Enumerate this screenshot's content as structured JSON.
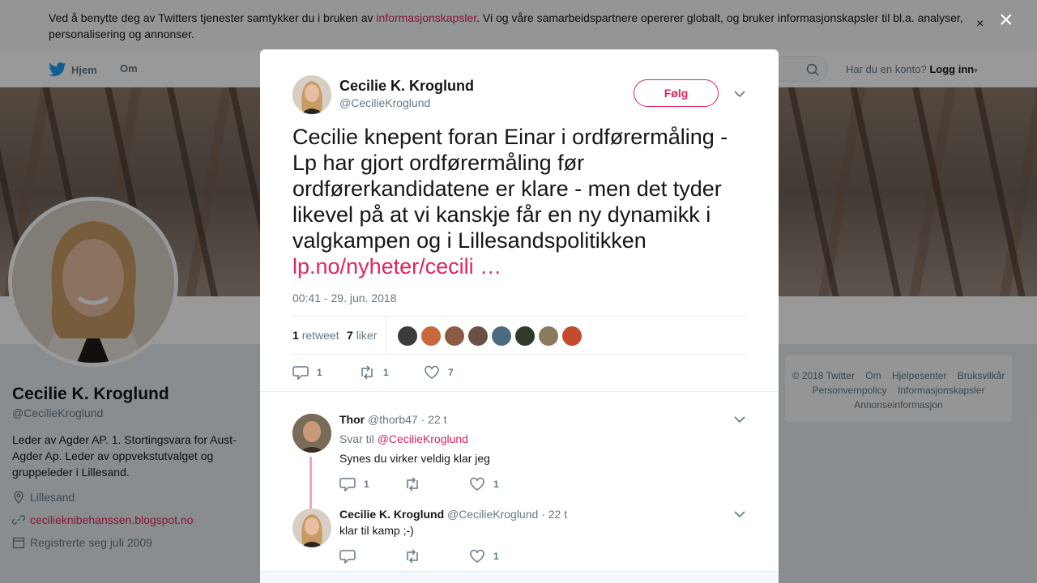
{
  "cookie": {
    "text_before": "Ved å benytte deg av Twitters tjenester samtykker du i bruken av ",
    "link": "informasjonskapsler",
    "text_after": ". Vi og våre samarbeidspartnere opererer globalt, og bruker informasjonskapsler til bl.a. analyser, personalisering og annonser.",
    "close": "×"
  },
  "nav": {
    "home": "Hjem",
    "about": "Om",
    "account_q": "Har du en konto?",
    "login": "Logg inn"
  },
  "profile": {
    "name": "Cecilie K. Kroglund",
    "handle": "@CecilieKroglund",
    "bio": "Leder av Agder AP. 1. Stortingsvara for Aust-Agder Ap. Leder av oppvekstutvalget og gruppeleder i Lillesand.",
    "location": "Lillesand",
    "website": "cecilieknibehanssen.blogspot.no",
    "joined": "Registrerte seg juli 2009"
  },
  "footer": {
    "line1": [
      "© 2018 Twitter",
      "Om",
      "Hjelpesenter",
      "Bruksvilkår"
    ],
    "line2": [
      "Personvernpolicy",
      "Informasjonskapsler"
    ],
    "line3": [
      "Annonseinformasjon"
    ]
  },
  "modal": {
    "close": "×",
    "author_name": "Cecilie K. Kroglund",
    "author_handle": "@CecilieKroglund",
    "follow": "Følg",
    "tweet_text": "Cecilie knepent foran Einar i ordførermåling - Lp har gjort ordførermåling før ordførerkandidatene er klare - men det tyder likevel på at vi kanskje får en ny dynamikk i valgkampen og i Lillesandspolitikken",
    "tweet_link": " lp.no/nyheter/cecili …",
    "time": "00:41 - 29. jun. 2018",
    "retweets_count": "1",
    "retweets_label": "retweet",
    "likes_count": "7",
    "likes_label": "liker",
    "liker_colors": [
      "#3b3b3b",
      "#c9683f",
      "#8c5a46",
      "#6b5044",
      "#4e6a82",
      "#2f3a2c",
      "#8a7a5e",
      "#c44a2e"
    ],
    "actions": {
      "replies": "1",
      "retweets": "1",
      "likes": "7"
    },
    "replies": [
      {
        "name": "Thor",
        "handle": "@thorb47",
        "time": "· 22 t",
        "reply_to_label": "Svar til",
        "reply_to": "@CecilieKroglund",
        "text": "Synes du virker veldig klar jeg",
        "replies": "1",
        "retweets": "",
        "likes": "1"
      },
      {
        "name": "Cecilie K. Kroglund",
        "handle": "@CecilieKroglund",
        "time": "· 22 t",
        "text": "klar til kamp ;-)",
        "replies": "",
        "retweets": "",
        "likes": "1"
      }
    ]
  },
  "colors": {
    "accent": "#e0245e",
    "twitter_blue": "#1da1f2"
  }
}
